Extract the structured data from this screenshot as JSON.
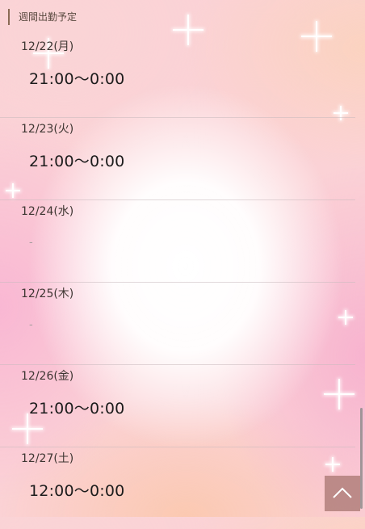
{
  "header": {
    "title": "週間出勤予定"
  },
  "schedule": [
    {
      "date": "12/22(月)",
      "time": "21:00〜0:00"
    },
    {
      "date": "12/23(火)",
      "time": "21:00〜0:00"
    },
    {
      "date": "12/24(水)",
      "time": "-"
    },
    {
      "date": "12/25(木)",
      "time": "-"
    },
    {
      "date": "12/26(金)",
      "time": "21:00〜0:00"
    },
    {
      "date": "12/27(土)",
      "time": "12:00〜0:00"
    }
  ],
  "icons": {
    "back_to_top": "chevron-up-icon"
  }
}
